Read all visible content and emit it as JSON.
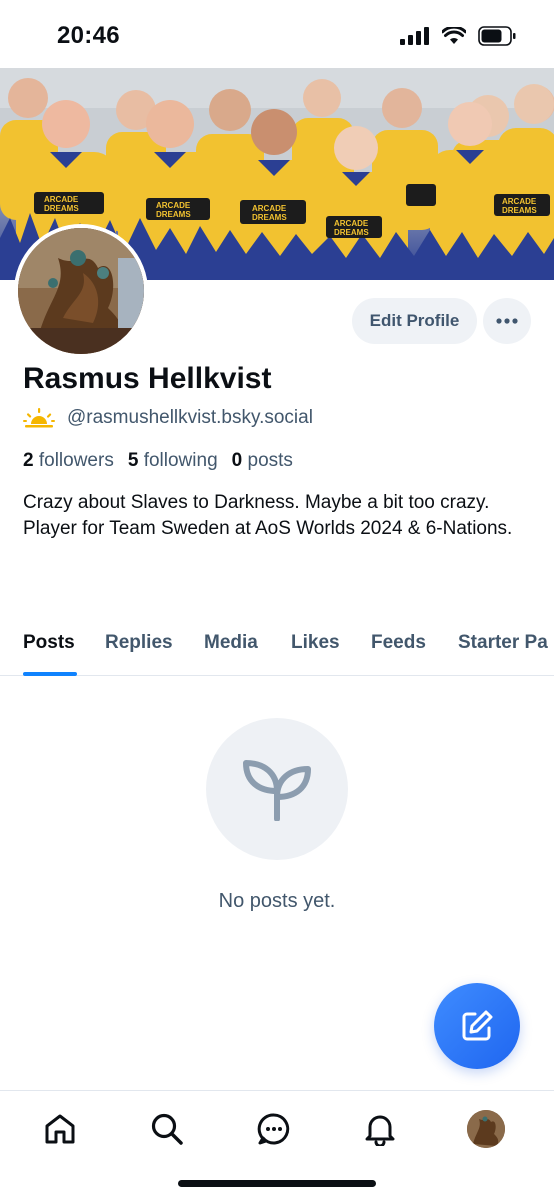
{
  "status_bar": {
    "time": "20:46",
    "signal_icon": "cellular-signal-icon",
    "wifi_icon": "wifi-icon",
    "battery_icon": "battery-icon"
  },
  "profile": {
    "display_name": "Rasmus Hellkvist",
    "handle": "@rasmushellkvist.bsky.social",
    "handle_badge_icon": "sunrise-icon",
    "stats": [
      {
        "count": "2",
        "label": "followers"
      },
      {
        "count": "5",
        "label": "following"
      },
      {
        "count": "0",
        "label": "posts"
      }
    ],
    "bio": "Crazy about Slaves to Darkness. Maybe a bit too crazy. Player for Team Sweden at AoS Worlds 2024 & 6-Nations.",
    "banner_shirt_text": [
      "ARCADE",
      "DREAMS"
    ]
  },
  "actions": {
    "edit_profile": "Edit Profile",
    "more_icon": "ellipsis-icon"
  },
  "tabs": [
    {
      "label": "Posts",
      "active": true
    },
    {
      "label": "Replies",
      "active": false
    },
    {
      "label": "Media",
      "active": false
    },
    {
      "label": "Likes",
      "active": false
    },
    {
      "label": "Feeds",
      "active": false
    },
    {
      "label": "Starter Pa",
      "active": false
    }
  ],
  "empty_state": {
    "text": "No posts yet.",
    "icon": "sprout-icon"
  },
  "fab": {
    "icon": "compose-icon"
  },
  "bottom_nav": [
    {
      "icon": "home-icon"
    },
    {
      "icon": "search-icon"
    },
    {
      "icon": "chat-icon"
    },
    {
      "icon": "bell-icon"
    },
    {
      "icon": "profile-avatar"
    }
  ],
  "colors": {
    "accent": "#1083fe",
    "fab": "#2f7bff",
    "banner_shirt": "#f2c230",
    "banner_shirt_dark": "#2b3f93",
    "text_primary": "#0b0f14",
    "text_secondary": "#42576c"
  }
}
